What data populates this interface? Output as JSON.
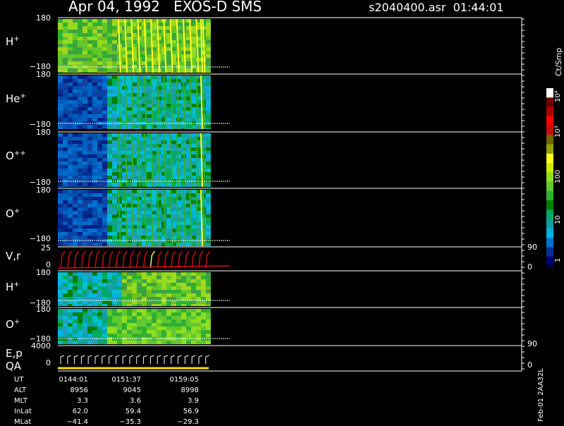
{
  "header": {
    "date": "Apr 04, 1992",
    "instrument": "EXOS-D SMS",
    "file": "s2040400.asr",
    "time": "01:44:01"
  },
  "colorbar": {
    "unit": "Ct/Smp",
    "labels": [
      "10⁴",
      "10³",
      "100",
      "10",
      "1"
    ],
    "colors": [
      "#000070",
      "#003090",
      "#0070d0",
      "#00b4e0",
      "#10a0a0",
      "#00aa60",
      "#008000",
      "#30b030",
      "#60c830",
      "#90dc20",
      "#d0e800",
      "#ffff20",
      "#90a000",
      "#706800",
      "#c01010",
      "#ff0000",
      "#b00000",
      "#700000",
      "#ffffff"
    ]
  },
  "panels": [
    {
      "label": "H",
      "sup": "+",
      "top": "180",
      "bottom": "−180"
    },
    {
      "label": "He",
      "sup": "+",
      "top": "180",
      "bottom": "−180"
    },
    {
      "label": "O",
      "sup": "++",
      "top": "180",
      "bottom": "−180"
    },
    {
      "label": "O",
      "sup": "+",
      "top": "180",
      "bottom": "−180"
    },
    {
      "label": "V,r",
      "sup": "",
      "top": "25",
      "bottom": "0",
      "rtop": "90",
      "rbottom": "0"
    },
    {
      "label": "H",
      "sup": "+",
      "top": "180",
      "bottom": "−180"
    },
    {
      "label": "O",
      "sup": "+",
      "top": "180",
      "bottom": "−180"
    },
    {
      "label": "E,p",
      "sup": "",
      "top": "4000",
      "bottom": "0",
      "rtop": "90",
      "rbottom": "0",
      "label2": "QA"
    }
  ],
  "table": {
    "rows": [
      {
        "name": "UT",
        "values": [
          "0144:01",
          "0151:37",
          "0159:05"
        ]
      },
      {
        "name": "ALT",
        "values": [
          "8956",
          "9045",
          "8998"
        ]
      },
      {
        "name": "MLT",
        "values": [
          "3.3",
          "3.6",
          "3.9"
        ]
      },
      {
        "name": "InLat",
        "values": [
          "62.0",
          "59.4",
          "56.9"
        ]
      },
      {
        "name": "MLat",
        "values": [
          "−41.4",
          "−35.3",
          "−29.3"
        ]
      }
    ]
  },
  "side_stamp": "Feb-01 2AA32L",
  "chart_data": {
    "type": "heatmap",
    "title": "Apr 04, 1992   EXOS-D SMS",
    "ylim": [
      -180,
      180
    ],
    "colorscale": "log",
    "colorbar_range": [
      1,
      10000
    ]
  }
}
